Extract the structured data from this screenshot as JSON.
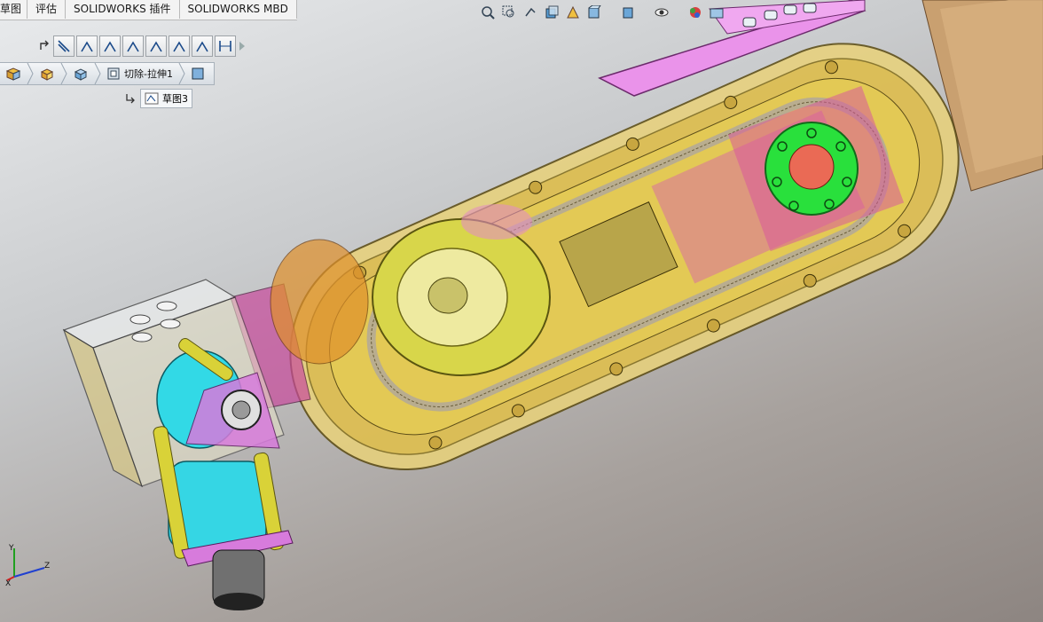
{
  "tabs": [
    "草图",
    "评估",
    "SOLIDWORKS 插件",
    "SOLIDWORKS MBD"
  ],
  "breadcrumb": {
    "feature": "切除-拉伸1",
    "sketch": "草图3"
  },
  "hud_icons": [
    "zoom-to-fit-icon",
    "zoom-area-icon",
    "previous-view-icon",
    "section-view-icon",
    "dynamic-annotation-icon",
    "view-orientation-icon",
    "display-style-icon",
    "hide-show-icon",
    "edit-appearance-icon",
    "apply-scene-icon",
    "view-settings-icon",
    "display-pane-icon"
  ],
  "relation_icons": [
    "line-icon",
    "angle-icon",
    "angle-icon",
    "angle-icon",
    "angle-icon",
    "angle-icon",
    "angle-icon",
    "distance-icon"
  ],
  "triad": {
    "x": "X",
    "y": "Y",
    "z": "Z"
  },
  "colors": {
    "housing": "#e7c34a",
    "pulley_green": "#27e83b",
    "motor_cyan": "#32d9e6",
    "pink": "#e58be6",
    "flange": "#c84a9c"
  }
}
